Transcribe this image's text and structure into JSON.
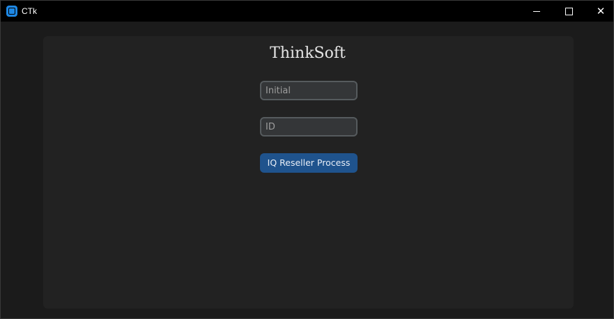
{
  "window": {
    "title": "CTk",
    "icon": "ctk-app-icon",
    "controls": {
      "minimize_icon": "minimize-icon",
      "maximize_icon": "maximize-icon",
      "close_glyph": "✕"
    }
  },
  "main": {
    "brand": "ThinkSoft",
    "initial_field": {
      "placeholder": "Initial",
      "value": ""
    },
    "id_field": {
      "placeholder": "ID",
      "value": ""
    },
    "process_button": {
      "label": "IQ Reseller Process"
    }
  },
  "colors": {
    "background": "#1b1b1b",
    "frame": "#222222",
    "entry_fill": "#343638",
    "entry_border": "#565b5e",
    "button": "#1f538d",
    "accent_icon": "#1e88e5"
  }
}
